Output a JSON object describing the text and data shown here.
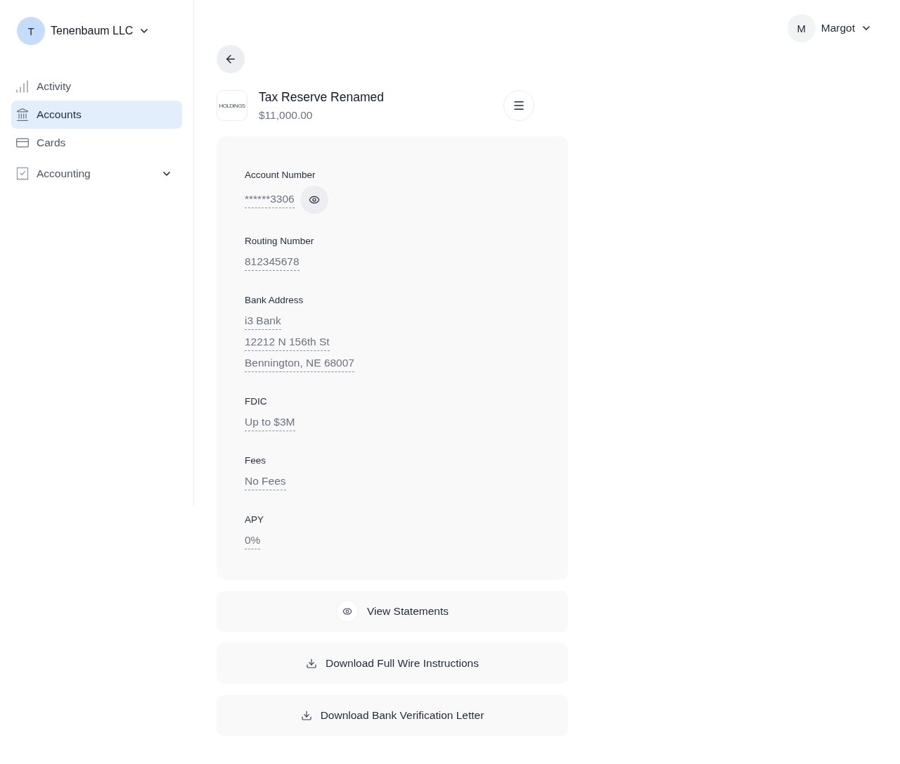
{
  "organization": {
    "initial": "T",
    "name": "Tenenbaum LLC"
  },
  "sidebar": {
    "items": [
      {
        "label": "Activity",
        "selected": false
      },
      {
        "label": "Accounts",
        "selected": true
      },
      {
        "label": "Cards",
        "selected": false
      },
      {
        "label": "Accounting",
        "selected": false,
        "expanded": false
      }
    ]
  },
  "user": {
    "initial": "M",
    "name": "Margot"
  },
  "account": {
    "logo_text": "HOLDINGS",
    "name": "Tax Reserve Renamed",
    "balance": "$11,000.00"
  },
  "details": [
    {
      "label": "Account Number",
      "kind": "masked",
      "lines": [
        "******3306"
      ]
    },
    {
      "label": "Routing Number",
      "kind": "text",
      "lines": [
        "812345678"
      ]
    },
    {
      "label": "Bank Address",
      "kind": "text",
      "lines": [
        "i3 Bank",
        "12212 N 156th St",
        "Bennington, NE 68007"
      ]
    },
    {
      "label": "FDIC",
      "kind": "text",
      "lines": [
        "Up to $3M"
      ]
    },
    {
      "label": "Fees",
      "kind": "text",
      "lines": [
        "No Fees"
      ]
    },
    {
      "label": "APY",
      "kind": "text",
      "lines": [
        "0%"
      ]
    }
  ],
  "actions": [
    {
      "label": "View Statements",
      "kind": "view"
    },
    {
      "label": "Download Full Wire Instructions",
      "kind": "download"
    },
    {
      "label": "Download Bank Verification Letter",
      "kind": "download"
    }
  ]
}
